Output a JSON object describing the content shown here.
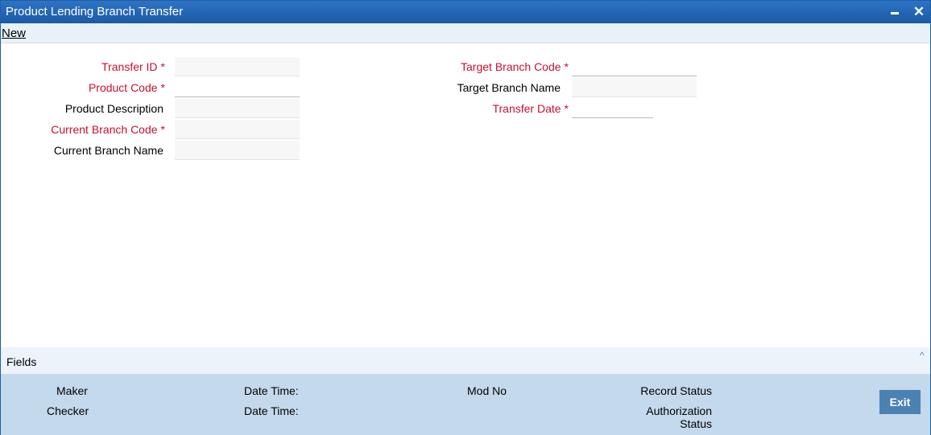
{
  "window": {
    "title": "Product Lending Branch Transfer",
    "minimize_glyph": "",
    "close_glyph": "✕"
  },
  "menu": {
    "new_label": "New"
  },
  "form": {
    "required_marker": "*",
    "transfer_id": {
      "label": "Transfer ID",
      "value": ""
    },
    "product_code": {
      "label": "Product Code",
      "value": ""
    },
    "product_description": {
      "label": "Product Description",
      "value": ""
    },
    "current_branch_code": {
      "label": "Current Branch Code",
      "value": ""
    },
    "current_branch_name": {
      "label": "Current Branch Name",
      "value": ""
    },
    "target_branch_code": {
      "label": "Target Branch Code",
      "value": ""
    },
    "target_branch_name": {
      "label": "Target Branch Name",
      "value": ""
    },
    "transfer_date": {
      "label": "Transfer Date",
      "value": ""
    }
  },
  "fields_bar": {
    "label": "Fields",
    "caret_icon": "chevron-up-icon",
    "caret_glyph": "^"
  },
  "audit": {
    "maker": "Maker",
    "checker": "Checker",
    "maker_date_time": "Date Time:",
    "checker_date_time": "Date Time:",
    "mod_no": "Mod No",
    "record_status": "Record Status",
    "authorization_line1": "Authorization",
    "authorization_line2": "Status",
    "exit_label": "Exit"
  },
  "colors": {
    "title_bar": "#1b5aa6",
    "required_label": "#c8102e",
    "audit_panel": "#c4d9ec",
    "exit_button": "#4a82b4"
  }
}
